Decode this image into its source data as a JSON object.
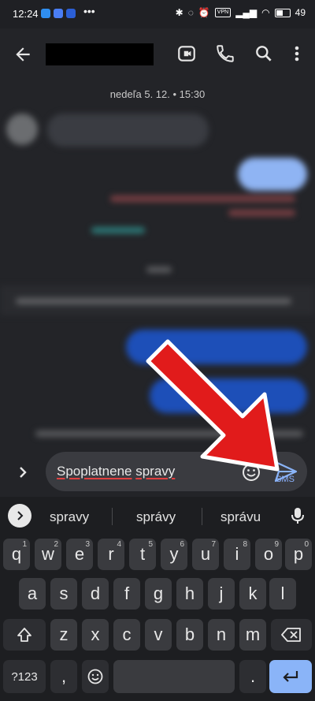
{
  "status_bar": {
    "time": "12:24",
    "vpn_label": "VPN",
    "battery": "49"
  },
  "app_bar": {
    "back_icon": "arrow-left-icon",
    "video_icon": "video-call-icon",
    "phone_icon": "phone-icon",
    "search_icon": "search-icon",
    "more_icon": "more-vertical-icon"
  },
  "conversation": {
    "date": "nedeľa 5. 12. • 15:30"
  },
  "composer": {
    "text_word1": "Spoplatnene",
    "text_word2": "spravy",
    "send_label": "SMS"
  },
  "keyboard": {
    "suggestions": [
      "spravy",
      "správy",
      "správu"
    ],
    "row1": [
      {
        "key": "q",
        "num": "1"
      },
      {
        "key": "w",
        "num": "2"
      },
      {
        "key": "e",
        "num": "3"
      },
      {
        "key": "r",
        "num": "4"
      },
      {
        "key": "t",
        "num": "5"
      },
      {
        "key": "y",
        "num": "6"
      },
      {
        "key": "u",
        "num": "7"
      },
      {
        "key": "i",
        "num": "8"
      },
      {
        "key": "o",
        "num": "9"
      },
      {
        "key": "p",
        "num": "0"
      }
    ],
    "row2": [
      "a",
      "s",
      "d",
      "f",
      "g",
      "h",
      "j",
      "k",
      "l"
    ],
    "row3": [
      "z",
      "x",
      "c",
      "v",
      "b",
      "n",
      "m"
    ],
    "symbols_key": "?123",
    "comma_key": ",",
    "period_key": "."
  },
  "colors": {
    "accent": "#8ab4f8",
    "arrow": "#e11b1b"
  }
}
